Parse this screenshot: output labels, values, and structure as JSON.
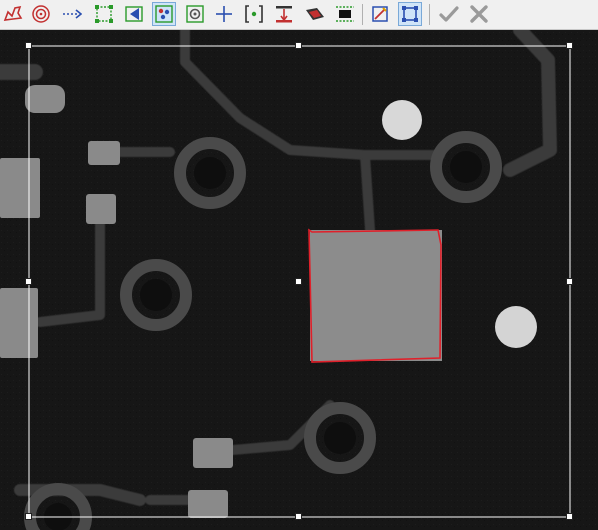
{
  "toolbar": {
    "tools": [
      {
        "icon": "freehand-region-icon",
        "active": false
      },
      {
        "icon": "concentric-circle-icon",
        "active": false
      },
      {
        "icon": "dotted-arrow-icon",
        "active": false
      },
      {
        "icon": "rectangle-region-icon",
        "active": false
      },
      {
        "icon": "trapezoid-region-icon",
        "active": false
      },
      {
        "icon": "blob-detect-icon",
        "active": true
      },
      {
        "icon": "circle-region-icon",
        "active": false
      },
      {
        "icon": "crosshair-icon",
        "active": false
      },
      {
        "icon": "center-bracket-icon",
        "active": false
      },
      {
        "icon": "height-measure-icon",
        "active": false
      },
      {
        "icon": "projection-icon",
        "active": false
      },
      {
        "icon": "chip-inspect-icon",
        "active": false
      },
      {
        "icon": "edit-region-icon",
        "active": false
      },
      {
        "icon": "fit-region-icon",
        "active": true
      },
      {
        "icon": "check-icon",
        "active": false
      },
      {
        "icon": "cancel-x-icon",
        "active": false
      }
    ]
  },
  "colors": {
    "roi_outline": "#ffffff",
    "detected_contour": "#e0202a",
    "background": "#161616"
  }
}
